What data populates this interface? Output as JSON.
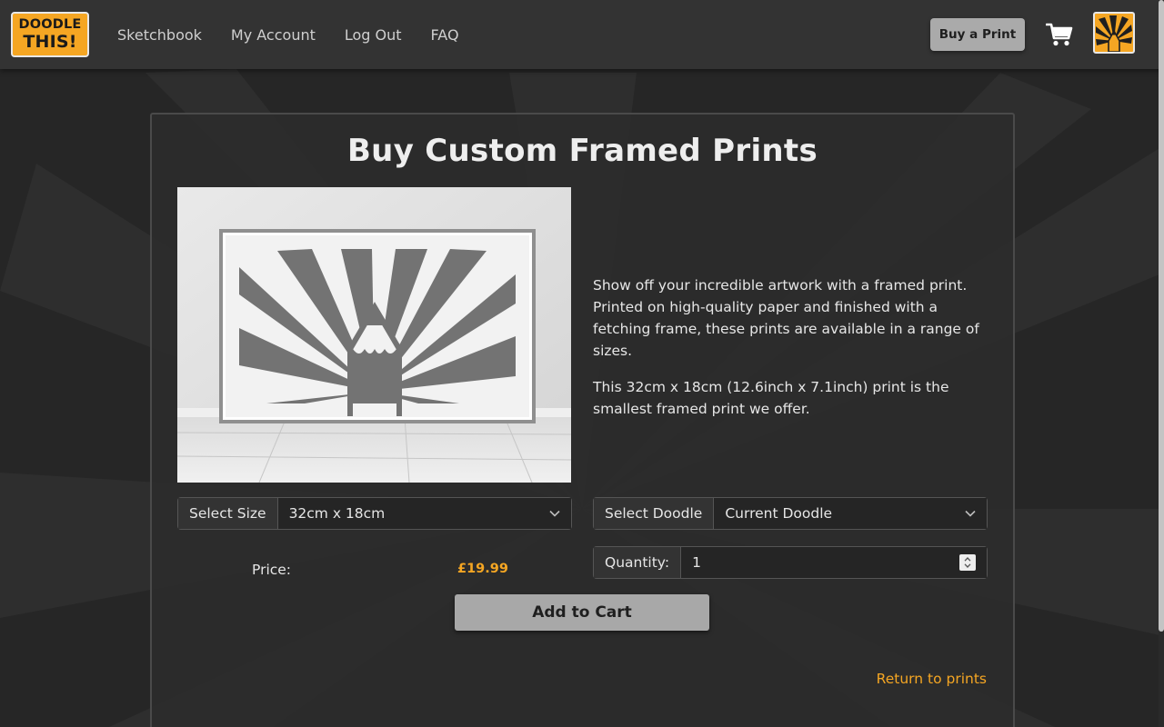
{
  "header": {
    "logo": {
      "line1": "DOODLE",
      "line2": "THIS!"
    },
    "nav": [
      "Sketchbook",
      "My Account",
      "Log Out",
      "FAQ"
    ],
    "buy_print_label": "Buy a Print",
    "cart_icon": "shopping-cart-icon",
    "avatar_icon": "pencil-sunburst-icon"
  },
  "colors": {
    "accent": "#f5a623",
    "background": "#262626",
    "header_bg": "#333333",
    "button_bg": "#a8a8a8"
  },
  "main": {
    "title": "Buy Custom Framed Prints",
    "description": [
      "Show off your incredible artwork with a framed print. Printed on high-quality paper and finished with a fetching frame, these prints are available in a range of sizes.",
      "This 32cm x 18cm (12.6inch x 7.1inch) print is the smallest framed print we offer."
    ],
    "size_select": {
      "label": "Select Size",
      "value": "32cm x 18cm"
    },
    "doodle_select": {
      "label": "Select Doodle",
      "value": "Current Doodle"
    },
    "price": {
      "label": "Price:",
      "value": "£19.99"
    },
    "quantity": {
      "label": "Quantity:",
      "value": "1"
    },
    "add_to_cart_label": "Add to Cart",
    "return_link": "Return to prints"
  }
}
